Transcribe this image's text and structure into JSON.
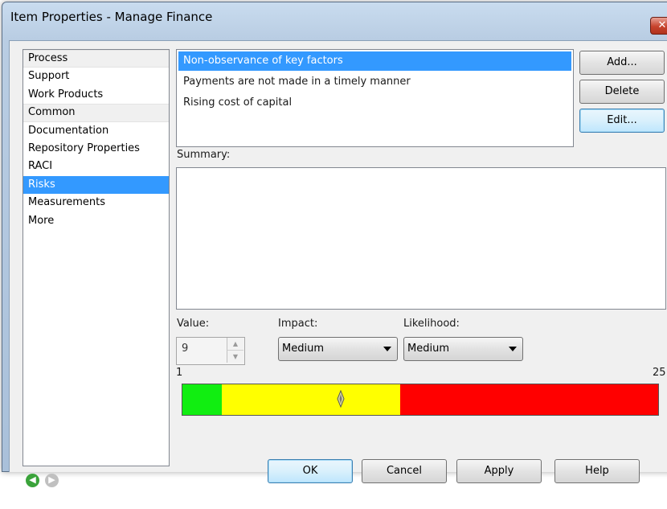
{
  "window": {
    "title": "Item Properties - Manage Finance",
    "close_glyph": "✕"
  },
  "nav": {
    "items": [
      {
        "label": "Process",
        "kind": "header"
      },
      {
        "label": "Support",
        "kind": "item"
      },
      {
        "label": "Work Products",
        "kind": "item"
      },
      {
        "label": "Common",
        "kind": "header"
      },
      {
        "label": "Documentation",
        "kind": "item"
      },
      {
        "label": "Repository Properties",
        "kind": "item"
      },
      {
        "label": "RACI",
        "kind": "item"
      },
      {
        "label": "Risks",
        "kind": "selected"
      },
      {
        "label": "Measurements",
        "kind": "item"
      },
      {
        "label": "More",
        "kind": "item"
      }
    ]
  },
  "risks": {
    "items": [
      {
        "label": "Non-observance of key factors",
        "selected": true
      },
      {
        "label": "Payments are not made in a timely manner",
        "selected": false
      },
      {
        "label": "Rising cost of capital",
        "selected": false
      }
    ]
  },
  "buttons": {
    "add": "Add...",
    "delete": "Delete",
    "edit": "Edit..."
  },
  "summary": {
    "label": "Summary:",
    "value": ""
  },
  "value_field": {
    "label": "Value:",
    "value": "9"
  },
  "impact": {
    "label": "Impact:",
    "selected": "Medium"
  },
  "likelihood": {
    "label": "Likelihood:",
    "selected": "Medium"
  },
  "gauge": {
    "min_label": "1",
    "max_label": "25",
    "min": 1,
    "max": 25,
    "value": 9,
    "zones": [
      {
        "name": "low",
        "from": 1,
        "to": 3,
        "color": "#11ee11"
      },
      {
        "name": "medium",
        "from": 3,
        "to": 12,
        "color": "#ffff00"
      },
      {
        "name": "high",
        "from": 12,
        "to": 25,
        "color": "#ff0000"
      }
    ]
  },
  "footer": {
    "ok": "OK",
    "cancel": "Cancel",
    "apply": "Apply",
    "help": "Help"
  },
  "icons": {
    "back": "back-arrow-icon",
    "forward": "forward-arrow-icon"
  },
  "colors": {
    "selection": "#3399ff",
    "back_arrow": "#3aa33a",
    "forward_arrow": "#c0c0c0"
  }
}
